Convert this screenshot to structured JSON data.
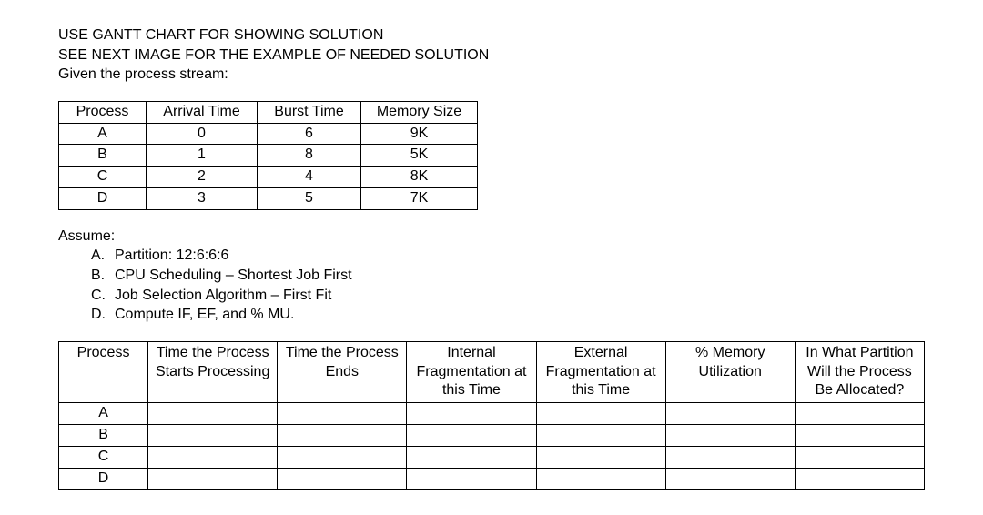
{
  "heading": {
    "line1": "USE GANTT CHART FOR SHOWING SOLUTION",
    "line2": "SEE NEXT IMAGE FOR THE EXAMPLE OF NEEDED SOLUTION",
    "line3": "Given the process stream:"
  },
  "process_table": {
    "headers": {
      "process": "Process",
      "arrival": "Arrival Time",
      "burst": "Burst Time",
      "memory": "Memory Size"
    },
    "rows": [
      {
        "process": "A",
        "arrival": "0",
        "burst": "6",
        "memory": "9K"
      },
      {
        "process": "B",
        "arrival": "1",
        "burst": "8",
        "memory": "5K"
      },
      {
        "process": "C",
        "arrival": "2",
        "burst": "4",
        "memory": "8K"
      },
      {
        "process": "D",
        "arrival": "3",
        "burst": "5",
        "memory": "7K"
      }
    ]
  },
  "assume": {
    "title": "Assume:",
    "items": [
      {
        "marker": "A.",
        "text": "Partition: 12:6:6:6"
      },
      {
        "marker": "B.",
        "text": "CPU Scheduling – Shortest Job First"
      },
      {
        "marker": "C.",
        "text": "Job Selection Algorithm – First Fit"
      },
      {
        "marker": "D.",
        "text": "Compute IF, EF, and % MU."
      }
    ]
  },
  "answer_table": {
    "headers": {
      "process": "Process",
      "start": "Time the Process Starts Processing",
      "end": "Time the Process Ends",
      "internal": "Internal Fragmentation at this Time",
      "external": "External Fragmentation at this Time",
      "memutil": "% Memory Utilization",
      "partition": "In What Partition Will the Process Be Allocated?"
    },
    "rows": [
      {
        "process": "A",
        "start": "",
        "end": "",
        "internal": "",
        "external": "",
        "memutil": "",
        "partition": ""
      },
      {
        "process": "B",
        "start": "",
        "end": "",
        "internal": "",
        "external": "",
        "memutil": "",
        "partition": ""
      },
      {
        "process": "C",
        "start": "",
        "end": "",
        "internal": "",
        "external": "",
        "memutil": "",
        "partition": ""
      },
      {
        "process": "D",
        "start": "",
        "end": "",
        "internal": "",
        "external": "",
        "memutil": "",
        "partition": ""
      }
    ]
  }
}
